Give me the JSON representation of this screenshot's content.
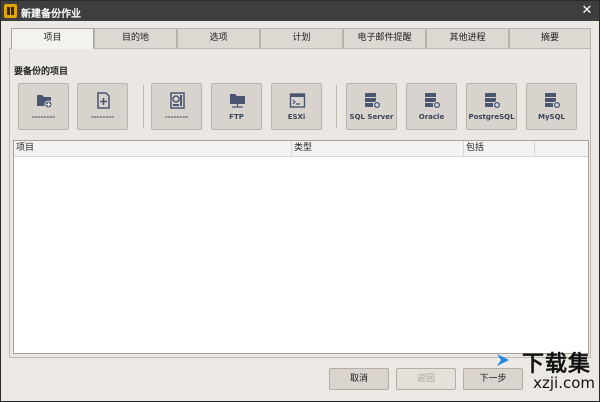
{
  "window": {
    "title": "新建备份作业"
  },
  "tabs": [
    {
      "label": "项目",
      "active": true
    },
    {
      "label": "目的地",
      "active": false
    },
    {
      "label": "选项",
      "active": false
    },
    {
      "label": "计划",
      "active": false
    },
    {
      "label": "电子邮件提醒",
      "active": false
    },
    {
      "label": "其他进程",
      "active": false
    },
    {
      "label": "摘要",
      "active": false
    }
  ],
  "section": {
    "label": "要备份的项目"
  },
  "sources": [
    {
      "icon": "folder-add-icon",
      "label": "--------"
    },
    {
      "icon": "file-add-icon",
      "label": "--------"
    },
    {
      "icon": "disk-icon",
      "label": "--------"
    },
    {
      "icon": "ftp-folder-icon",
      "label": "FTP"
    },
    {
      "icon": "esxi-icon",
      "label": "ESXi"
    },
    {
      "icon": "sql-server-icon",
      "label": "SQL Server"
    },
    {
      "icon": "oracle-icon",
      "label": "Oracle"
    },
    {
      "icon": "postgresql-icon",
      "label": "PostgreSQL"
    },
    {
      "icon": "mysql-icon",
      "label": "MySQL"
    }
  ],
  "table": {
    "columns": [
      "项目",
      "类型",
      "包括"
    ],
    "rows": []
  },
  "footer": {
    "cancel_label": "取消",
    "back_label": "返回",
    "next_label": "下一步"
  },
  "watermark": {
    "main": "下载集",
    "sub": "xzji.com"
  },
  "colors": {
    "titlebar": "#3e3e3e",
    "icon_blue": "#4a5572",
    "button_face": "#d8d3cc",
    "watermark_arrow": "#1e88e5"
  }
}
